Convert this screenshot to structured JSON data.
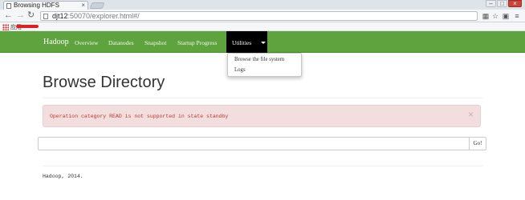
{
  "browser": {
    "tab_title": "Browsing HDFS",
    "tab_close": "×",
    "window_controls": [
      "–",
      "□",
      "×"
    ],
    "address": {
      "host": "djt12",
      "path": ":50070/explorer.html#/"
    },
    "icons": [
      "back-icon",
      "forward-icon",
      "reload-icon",
      "translate-icon",
      "star-icon",
      "extension-icon",
      "menu-icon"
    ],
    "bookmarks_label": "应用"
  },
  "navbar": {
    "brand": "Hadoop",
    "items": [
      "Overview",
      "Datanodes",
      "Snapshot",
      "Startup Progress"
    ],
    "active_item": "Utilities",
    "dropdown": [
      "Browse the file system",
      "Logs"
    ]
  },
  "main": {
    "title": "Browse Directory",
    "alert": {
      "message": "Operation category READ is not supported in state standby",
      "close": "×"
    },
    "search": {
      "value": "",
      "button": "Go!"
    },
    "footer": "Hadoop, 2014."
  },
  "colors": {
    "navbar": "#5fa33e",
    "active_tab": "#000000",
    "alert_bg": "#f2dede",
    "alert_text": "#c0392b"
  }
}
